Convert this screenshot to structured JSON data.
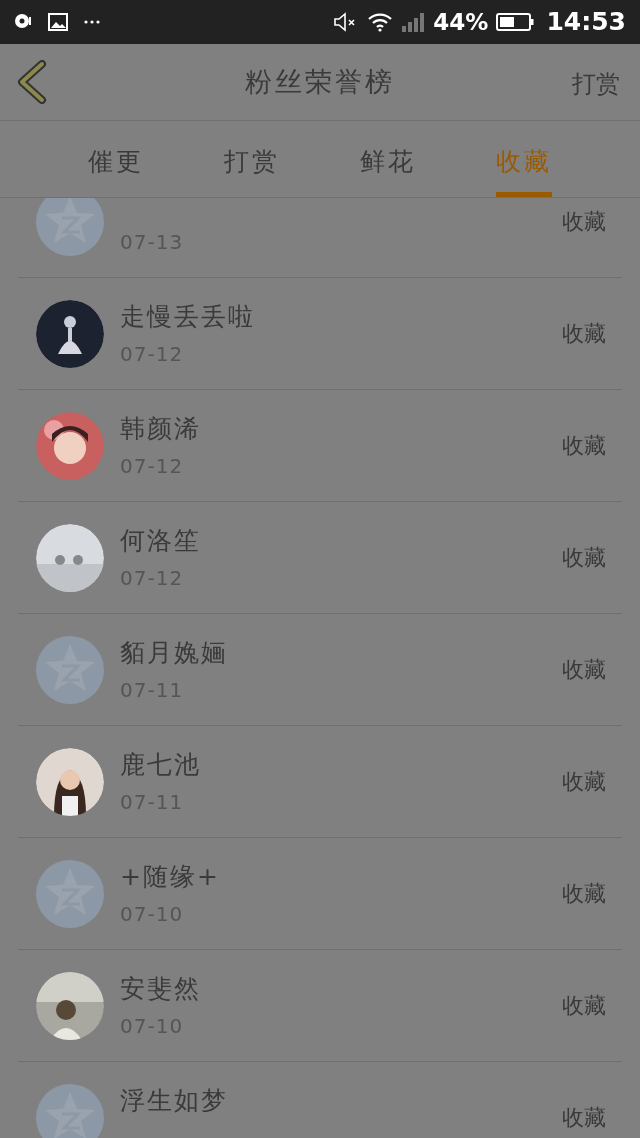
{
  "status_bar": {
    "battery": "44%",
    "time": "14:53"
  },
  "header": {
    "title": "粉丝荣誉榜",
    "action": "打赏"
  },
  "tabs": [
    {
      "label": "催更",
      "selected": false
    },
    {
      "label": "打赏",
      "selected": false
    },
    {
      "label": "鲜花",
      "selected": false
    },
    {
      "label": "收藏",
      "selected": true
    }
  ],
  "fans": [
    {
      "date": "07-13",
      "action": "收藏",
      "kind": "default"
    },
    {
      "name": "走慢丢丢啦",
      "date": "07-12",
      "action": "收藏"
    },
    {
      "name": "韩颜浠",
      "date": "07-12",
      "action": "收藏"
    },
    {
      "name": "何洛笙",
      "date": "07-12",
      "action": "收藏"
    },
    {
      "name": "貊月婏婳",
      "date": "07-11",
      "action": "收藏",
      "kind": "default"
    },
    {
      "name": "鹿七池",
      "date": "07-11",
      "action": "收藏"
    },
    {
      "name": "+随缘+",
      "date": "07-10",
      "action": "收藏",
      "kind": "default"
    },
    {
      "name": "安斐然",
      "date": "07-10",
      "action": "收藏"
    },
    {
      "name": "浮生如梦",
      "action": "收藏",
      "kind": "default"
    }
  ]
}
